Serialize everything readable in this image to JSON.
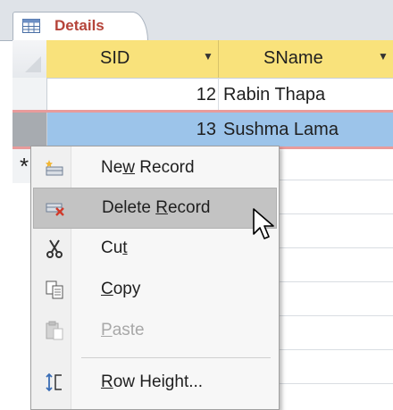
{
  "tab": {
    "label": "Details"
  },
  "columns": [
    {
      "label": "SID"
    },
    {
      "label": "SName"
    }
  ],
  "rows": [
    {
      "sid": "12",
      "sname": "Rabin Thapa"
    },
    {
      "sid": "13",
      "sname": "Sushma Lama"
    }
  ],
  "new_row_marker": "*",
  "context_menu": {
    "items": [
      {
        "pre": "Ne",
        "u": "w",
        "post": " Record",
        "icon": "new-record-icon"
      },
      {
        "pre": "Delete ",
        "u": "R",
        "post": "ecord",
        "icon": "delete-record-icon"
      },
      {
        "pre": "Cu",
        "u": "t",
        "post": "",
        "icon": "scissors-icon"
      },
      {
        "pre": "",
        "u": "C",
        "post": "opy",
        "icon": "copy-icon"
      },
      {
        "pre": "",
        "u": "P",
        "post": "aste",
        "icon": "paste-icon"
      },
      {
        "pre": "",
        "u": "R",
        "post": "ow Height...",
        "icon": "row-height-icon"
      }
    ]
  }
}
